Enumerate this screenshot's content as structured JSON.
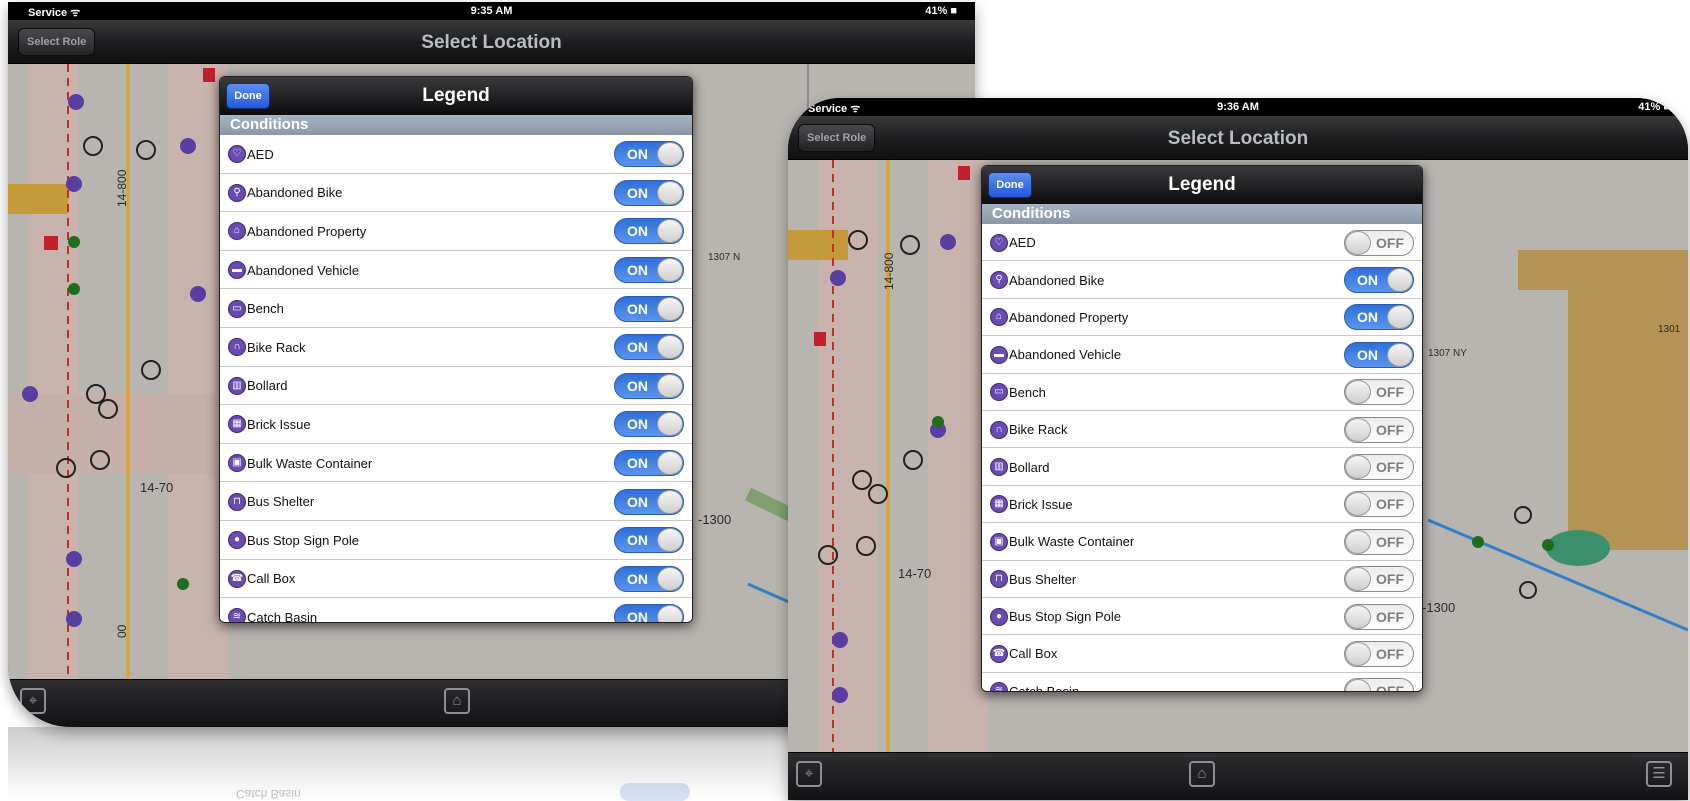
{
  "app": {
    "nav_title": "Select Role",
    "screen_title": "Select Location"
  },
  "screens": [
    {
      "status": {
        "carrier": "Service ᯤ",
        "time": "9:35 AM",
        "battery": "41% ■"
      },
      "legend": {
        "title": "Legend",
        "done_label": "Done",
        "section": "Conditions",
        "items": [
          {
            "label": "AED",
            "icon": "heart-icon",
            "state": "ON"
          },
          {
            "label": "Abandoned Bike",
            "icon": "bike-icon",
            "state": "ON"
          },
          {
            "label": "Abandoned Property",
            "icon": "house-icon",
            "state": "ON"
          },
          {
            "label": "Abandoned Vehicle",
            "icon": "car-icon",
            "state": "ON"
          },
          {
            "label": "Bench",
            "icon": "bench-icon",
            "state": "ON"
          },
          {
            "label": "Bike Rack",
            "icon": "bike-rack-icon",
            "state": "ON"
          },
          {
            "label": "Bollard",
            "icon": "bollard-icon",
            "state": "ON"
          },
          {
            "label": "Brick Issue",
            "icon": "brick-icon",
            "state": "ON"
          },
          {
            "label": "Bulk Waste Container",
            "icon": "waste-container-icon",
            "state": "ON"
          },
          {
            "label": "Bus Shelter",
            "icon": "bus-shelter-icon",
            "state": "ON"
          },
          {
            "label": "Bus Stop Sign Pole",
            "icon": "bus-stop-icon",
            "state": "ON"
          },
          {
            "label": "Call Box",
            "icon": "call-box-icon",
            "state": "ON"
          },
          {
            "label": "Catch Basin",
            "icon": "catch-basin-icon",
            "state": "ON"
          }
        ]
      },
      "map_labels": [
        "14-800",
        "14-70",
        "1307 N",
        "-1300",
        "00"
      ],
      "toolbar": {
        "locate_icon": "locate-icon",
        "home_icon": "home-icon"
      }
    },
    {
      "status": {
        "carrier": "Service ᯤ",
        "time": "9:36 AM",
        "battery": "41% ■"
      },
      "legend": {
        "title": "Legend",
        "done_label": "Done",
        "section": "Conditions",
        "items": [
          {
            "label": "AED",
            "icon": "heart-icon",
            "state": "OFF"
          },
          {
            "label": "Abandoned Bike",
            "icon": "bike-icon",
            "state": "ON"
          },
          {
            "label": "Abandoned Property",
            "icon": "house-icon",
            "state": "ON"
          },
          {
            "label": "Abandoned Vehicle",
            "icon": "car-icon",
            "state": "ON"
          },
          {
            "label": "Bench",
            "icon": "bench-icon",
            "state": "OFF"
          },
          {
            "label": "Bike Rack",
            "icon": "bike-rack-icon",
            "state": "OFF"
          },
          {
            "label": "Bollard",
            "icon": "bollard-icon",
            "state": "OFF"
          },
          {
            "label": "Brick Issue",
            "icon": "brick-icon",
            "state": "OFF"
          },
          {
            "label": "Bulk Waste Container",
            "icon": "waste-container-icon",
            "state": "OFF"
          },
          {
            "label": "Bus Shelter",
            "icon": "bus-shelter-icon",
            "state": "OFF"
          },
          {
            "label": "Bus Stop Sign Pole",
            "icon": "bus-stop-icon",
            "state": "OFF"
          },
          {
            "label": "Call Box",
            "icon": "call-box-icon",
            "state": "OFF"
          },
          {
            "label": "Catch Basin",
            "icon": "catch-basin-icon",
            "state": "OFF"
          }
        ]
      },
      "map_labels": [
        "14-800",
        "14-70",
        "1307 NY",
        "-1300",
        "1301"
      ],
      "toolbar": {
        "locate_icon": "locate-icon",
        "home_icon": "home-icon",
        "list_icon": "list-icon"
      }
    }
  ],
  "reflection": {
    "text": "Catch Basin",
    "state": "ON"
  },
  "colors": {
    "toggle_on": "#2f6fd9",
    "icon_purple": "#6a4bb0",
    "section_header": "#8997a9",
    "done_button": "#2359d8"
  }
}
